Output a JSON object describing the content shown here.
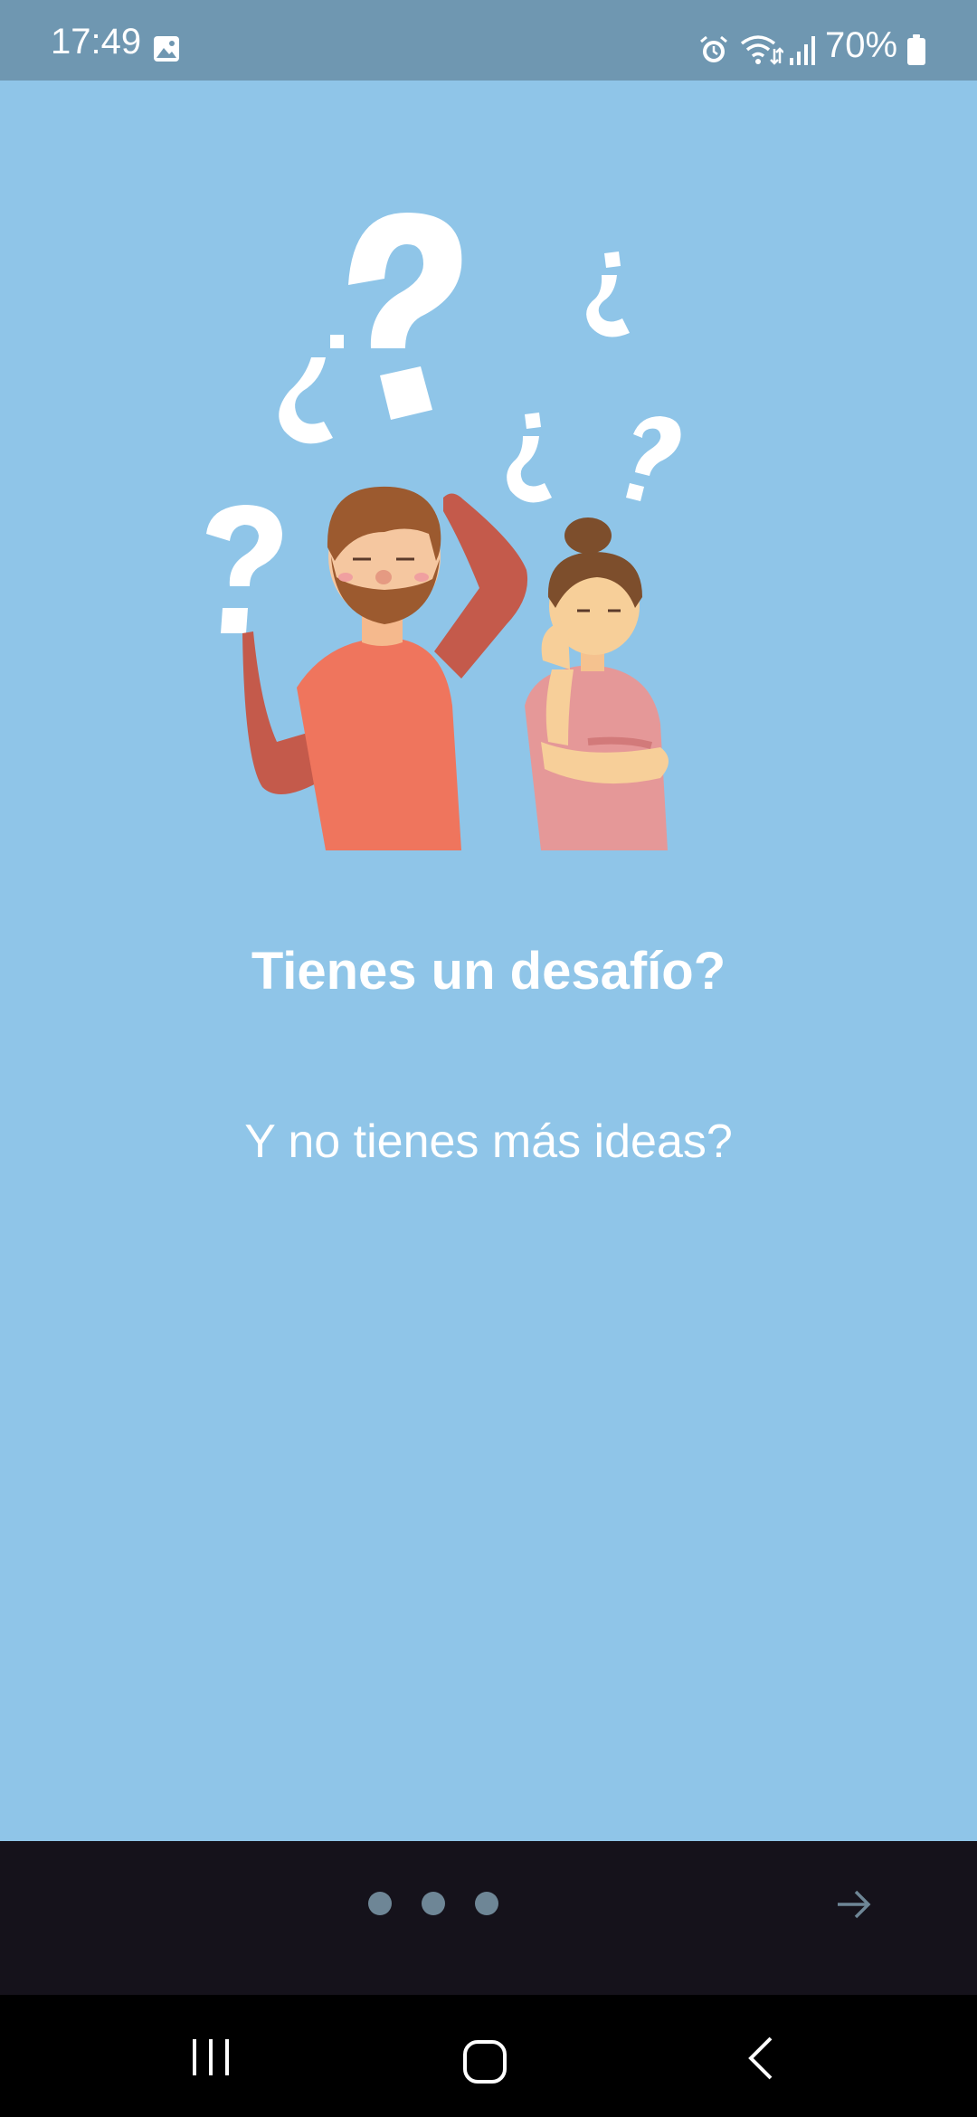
{
  "status_bar": {
    "time": "17:49",
    "battery": "70%",
    "icons": [
      "gallery-icon",
      "alarm-icon",
      "wifi-icon",
      "signal-icon",
      "battery-icon"
    ]
  },
  "illustration": {
    "name": "confused-couple-illustration"
  },
  "slide": {
    "title": "Tienes un desafío?",
    "subtitle": "Y no tienes más ideas?"
  },
  "pager": {
    "total_pages": 3,
    "current_page": 1
  },
  "navigation": {
    "next_icon": "arrow-right-icon"
  },
  "system_nav": {
    "icons": [
      "recents-icon",
      "home-icon",
      "back-icon"
    ]
  },
  "colors": {
    "background": "#8fc5e8",
    "status_bar": "#6f97b1",
    "bottom_bar": "#15121b",
    "dot": "#6e8696"
  }
}
